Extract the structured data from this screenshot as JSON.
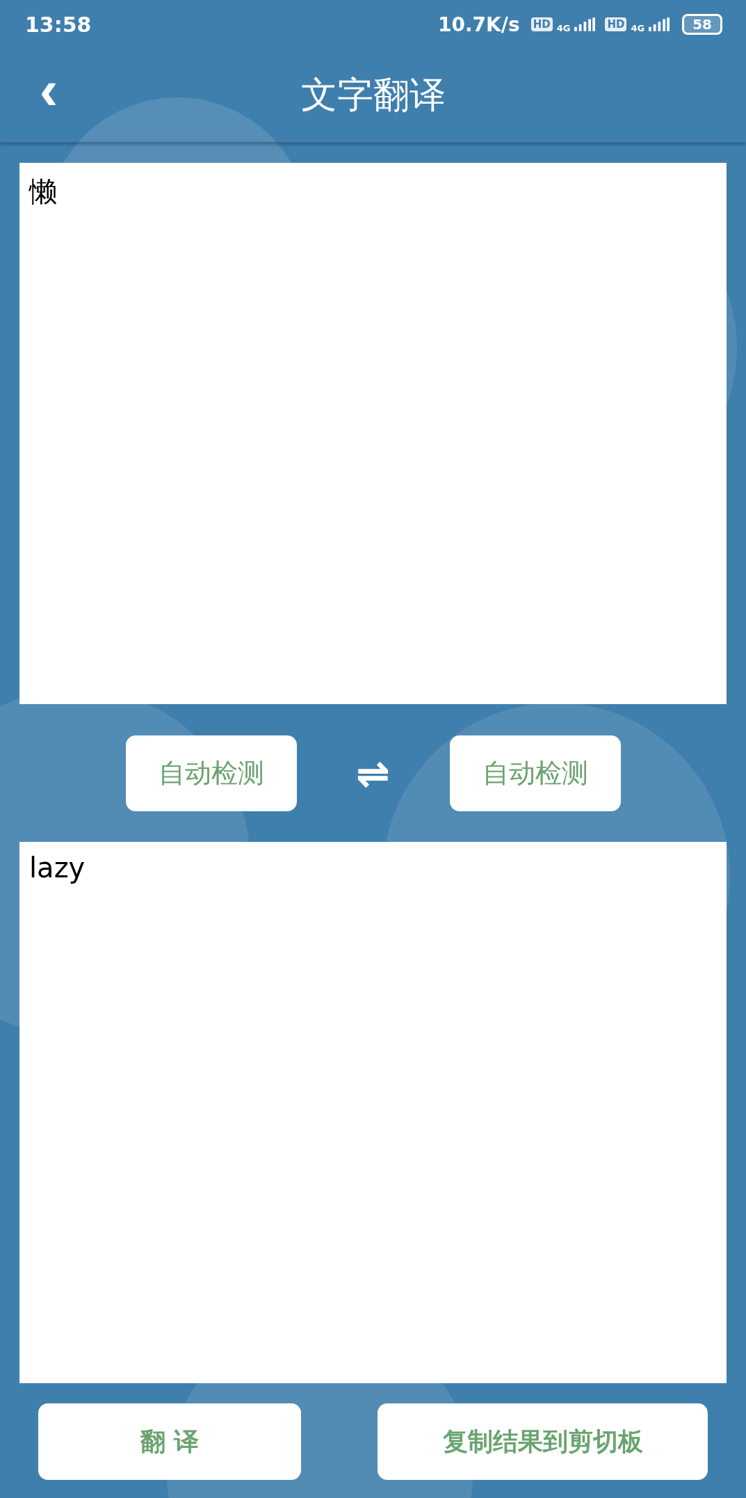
{
  "status_bar": {
    "time": "13:58",
    "network_speed": "10.7K/s",
    "sims": [
      {
        "hd": "HD",
        "network": "4G"
      },
      {
        "hd": "HD",
        "network": "4G"
      }
    ],
    "battery": "58"
  },
  "header": {
    "back": "‹",
    "title": "文字翻译"
  },
  "source": {
    "value": "懒"
  },
  "languages": {
    "from": "自动检测",
    "swap": "⇌",
    "to": "自动检测"
  },
  "result": {
    "value": "lazy"
  },
  "buttons": [
    {
      "label": "翻 译"
    },
    {
      "label": "复制结果到剪切板"
    }
  ]
}
